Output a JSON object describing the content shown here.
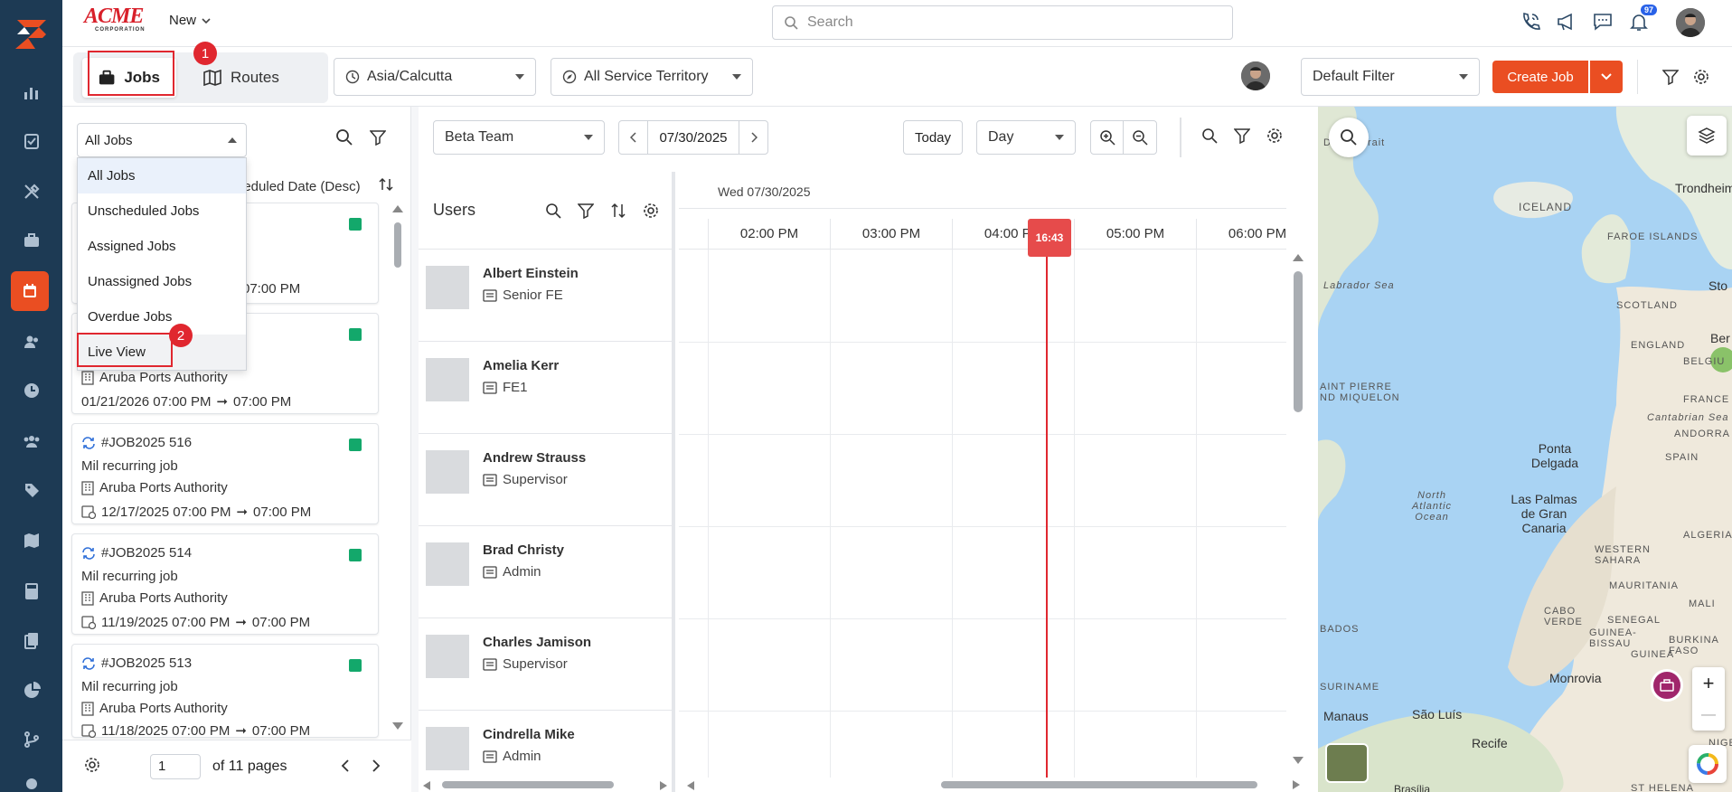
{
  "header": {
    "brand_main": "ACME",
    "brand_sub": "CORPORATION",
    "new_label": "New",
    "search_placeholder": "Search",
    "notification_count": "97"
  },
  "toolbar": {
    "tabs": [
      {
        "label": "Jobs"
      },
      {
        "label": "Routes"
      }
    ],
    "timezone": "Asia/Calcutta",
    "territory": "All Service Territory",
    "filter": "Default Filter",
    "create_label": "Create Job",
    "callouts": [
      "1",
      "2"
    ]
  },
  "jobs_panel": {
    "filter_value": "All Jobs",
    "sort_label": "heduled Date (Desc)",
    "dropdown_options": [
      "All Jobs",
      "Unscheduled Jobs",
      "Assigned Jobs",
      "Unassigned Jobs",
      "Overdue Jobs",
      "Live View"
    ],
    "cards": [
      {
        "id": "",
        "title": "",
        "customer": "",
        "date": "",
        "end": "07:00 PM"
      },
      {
        "id": "",
        "title": "",
        "customer": "Aruba Ports Authority",
        "date": "01/21/2026 07:00 PM",
        "end": "07:00 PM"
      },
      {
        "id": "#JOB2025 516",
        "title": "Mil recurring job",
        "customer": "Aruba Ports Authority",
        "date": "12/17/2025 07:00 PM",
        "end": "07:00 PM"
      },
      {
        "id": "#JOB2025 514",
        "title": "Mil recurring job",
        "customer": "Aruba Ports Authority",
        "date": "11/19/2025 07:00 PM",
        "end": "07:00 PM"
      },
      {
        "id": "#JOB2025 513",
        "title": "Mil recurring job",
        "customer": "Aruba Ports Authority",
        "date": "11/18/2025 07:00 PM",
        "end": "07:00 PM"
      }
    ],
    "page_value": "1",
    "page_total": "of 11 pages"
  },
  "scheduler": {
    "team": "Beta Team",
    "date": "07/30/2025",
    "today_label": "Today",
    "view": "Day",
    "users_title": "Users",
    "date_header": "Wed 07/30/2025",
    "hours": [
      "02:00 PM",
      "03:00 PM",
      "04:00 PM",
      "05:00 PM",
      "06:00 PM"
    ],
    "now_label": "16:43",
    "users": [
      {
        "name": "Albert Einstein",
        "role": "Senior FE"
      },
      {
        "name": "Amelia Kerr",
        "role": "FE1"
      },
      {
        "name": "Andrew Strauss",
        "role": "Supervisor"
      },
      {
        "name": "Brad Christy",
        "role": "Admin"
      },
      {
        "name": "Charles Jamison",
        "role": "Supervisor"
      },
      {
        "name": "Cindrella Mike",
        "role": "Admin"
      }
    ]
  },
  "map": {
    "labels": [
      "Davis Strait",
      "ICELAND",
      "FAROE ISLANDS",
      "Trondheim",
      "Labrador Sea",
      "SCOTLAND",
      "Sto",
      "ENGLAND",
      "Ber",
      "BELGIU",
      "AINT PIERRE ND MIQUELON",
      "FRANCE",
      "Cantabrian Sea",
      "ANDORRA",
      "Ponta Delgada",
      "SPAIN",
      "North Atlantic Ocean",
      "Las Palmas de Gran Canaria",
      "ALGERIA",
      "WESTERN SAHARA",
      "MAURITANIA",
      "MALI",
      "CABO VERDE",
      "SENEGAL",
      "GUINEA-BISSAU",
      "BURKINA FASO",
      "GUINEA",
      "BADOS",
      "Monrovia",
      "SURINAME",
      "Manaus",
      "São Luís",
      "Recife",
      "Brasília",
      "ST HELENA",
      "NIGE"
    ],
    "zoom_in": "+",
    "zoom_out": "—"
  },
  "colors": {
    "accent": "#ea4e22",
    "rail": "#1d3a54",
    "highlight": "#e0272f",
    "status": "#13a86b"
  }
}
